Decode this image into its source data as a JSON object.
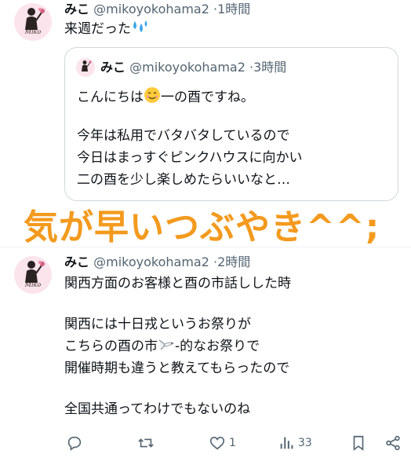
{
  "tweet1": {
    "name": "みこ",
    "handle": "@mikoyokohama2",
    "time_sep": "·",
    "time": "1時間",
    "text": "来週だった",
    "emoji_icon": "sweat-droplets-icon"
  },
  "quote": {
    "name": "みこ",
    "handle": "@mikoyokohama2",
    "time_sep": "·",
    "time": "3時間",
    "line1_before": "こんにちは",
    "line1_emoji": "smiling-face-icon",
    "line1_after": "一の酉ですね。",
    "line2": "今年は私用でバタバタしているので",
    "line3": "今日はまっすぐピンクハウスに向かい",
    "line4": "二の酉を少し楽しめたらいいなと…"
  },
  "overlay": {
    "text": "気が早いつぶやき^^;"
  },
  "tweet2": {
    "name": "みこ",
    "handle": "@mikoyokohama2",
    "time_sep": "·",
    "time": "2時間",
    "line1": "関西方面のお客様と酉の市話しした時",
    "line2": "関西には十日戎というお祭りが",
    "line3_before": "こちらの酉の市",
    "line3_icon": "flying-bird-icon",
    "line3_after": "-的なお祭りで",
    "line4": "開催時期も違うと教えてもらったので",
    "line5": "全国共通ってわけでもないのね",
    "actions": {
      "reply_icon": "reply-icon",
      "retweet_icon": "retweet-icon",
      "like_icon": "heart-icon",
      "like_count": "1",
      "views_icon": "views-icon",
      "views_count": "33",
      "bookmark_icon": "bookmark-icon",
      "share_icon": "share-icon"
    }
  },
  "avatar": {
    "label": "Miko"
  },
  "colors": {
    "accent_overlay": "#f39a1e",
    "secondary_text": "#536471",
    "border": "#cfd9de"
  }
}
